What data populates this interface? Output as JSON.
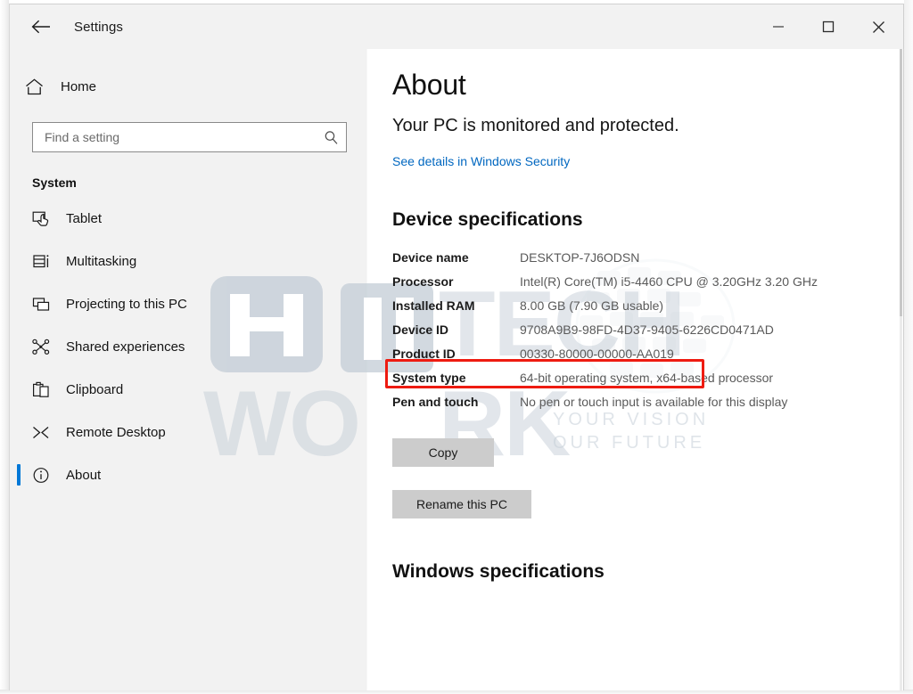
{
  "window": {
    "title": "Settings",
    "back_icon": "back-arrow-icon",
    "minimize_label": "—",
    "maximize_label": "□",
    "close_label": "✕"
  },
  "sidebar": {
    "home": {
      "label": "Home",
      "icon": "home-icon"
    },
    "search": {
      "placeholder": "Find a setting",
      "value": "",
      "icon": "search-icon"
    },
    "group_title": "System",
    "items": [
      {
        "label": "Tablet",
        "icon": "tablet-icon",
        "selected": false
      },
      {
        "label": "Multitasking",
        "icon": "multitasking-icon",
        "selected": false
      },
      {
        "label": "Projecting to this PC",
        "icon": "projecting-icon",
        "selected": false
      },
      {
        "label": "Shared experiences",
        "icon": "shared-experiences-icon",
        "selected": false
      },
      {
        "label": "Clipboard",
        "icon": "clipboard-icon",
        "selected": false
      },
      {
        "label": "Remote Desktop",
        "icon": "remote-desktop-icon",
        "selected": false
      },
      {
        "label": "About",
        "icon": "info-circle-icon",
        "selected": true
      }
    ]
  },
  "main": {
    "page_title": "About",
    "protection_status": "Your PC is monitored and protected.",
    "security_link": "See details in Windows Security",
    "device_specs_heading": "Device specifications",
    "specs": [
      {
        "key": "Device name",
        "value": "DESKTOP-7J6ODSN"
      },
      {
        "key": "Processor",
        "value": "Intel(R) Core(TM) i5-4460  CPU @ 3.20GHz   3.20 GHz"
      },
      {
        "key": "Installed RAM",
        "value": "8.00 GB (7.90 GB usable)"
      },
      {
        "key": "Device ID",
        "value": "9708A9B9-98FD-4D37-9405-6226CD0471AD"
      },
      {
        "key": "Product ID",
        "value": "00330-80000-00000-AA019"
      },
      {
        "key": "System type",
        "value": "64-bit operating system, x64-based processor"
      },
      {
        "key": "Pen and touch",
        "value": "No pen or touch input is available for this display"
      }
    ],
    "copy_button": "Copy",
    "rename_button": "Rename this PC",
    "windows_specs_heading": "Windows specifications"
  },
  "annotation": {
    "highlight_target": "Installed RAM",
    "highlight_color": "#ee1b11"
  },
  "watermark": {
    "brand_line1": "HI",
    "brand_line2": "WO",
    "brand_tech": "TECH",
    "brand_rk": "RK",
    "tagline_1": "YOUR VISION",
    "tagline_2": "OUR FUTURE",
    "color": "#c6cfd8"
  },
  "colors": {
    "accent": "#0078d7",
    "link": "#0067c0",
    "sidebar_bg": "#f2f2f2",
    "content_bg": "#ffffff",
    "highlight": "#ee1b11",
    "button_bg": "#cccccc"
  }
}
